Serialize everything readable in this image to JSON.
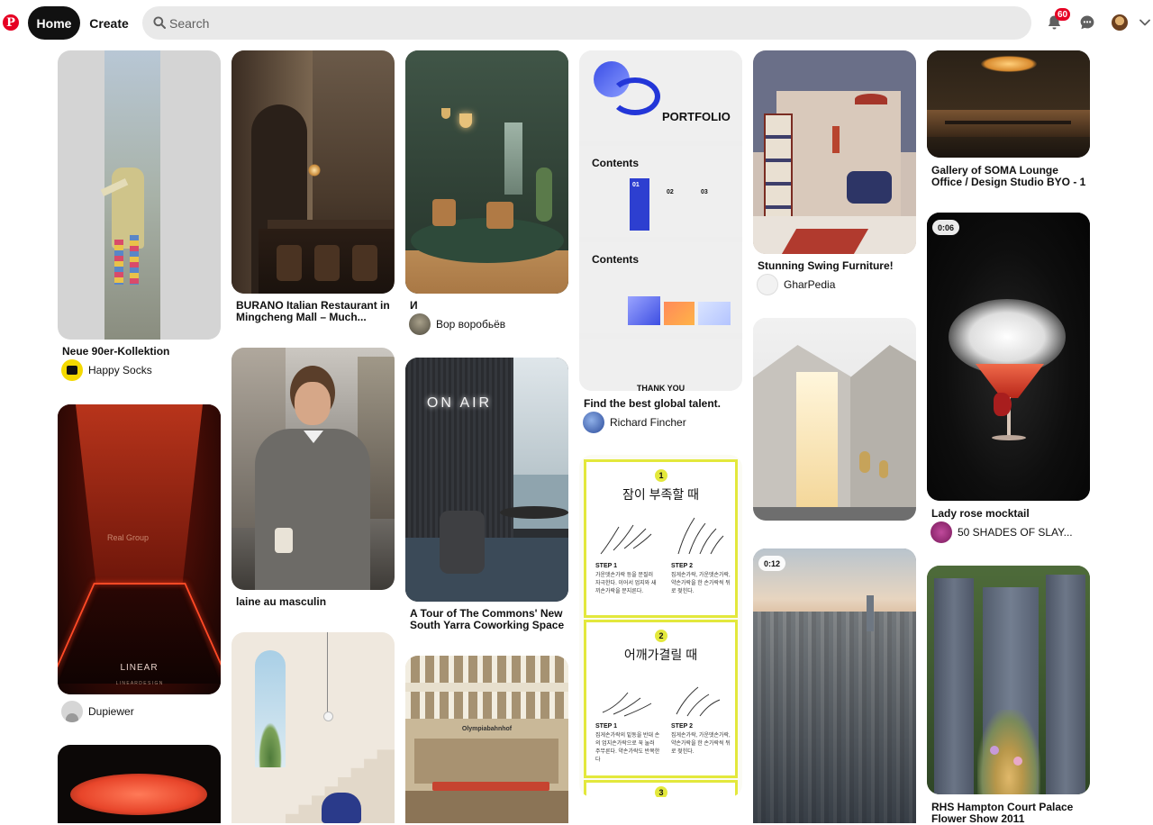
{
  "brand": {
    "logo_letter": "P",
    "accent": "#e60023"
  },
  "nav": {
    "home_label": "Home",
    "create_label": "Create"
  },
  "search": {
    "placeholder": "Search"
  },
  "header_icons": {
    "notifications": "bell-icon",
    "notification_count": "60",
    "messages": "chat-bubble-icon",
    "profile": "avatar",
    "account_menu": "chevron-down-icon"
  },
  "pins": [
    {
      "title": "Neue 90er-Kollektion",
      "author": "Happy Socks"
    },
    {
      "title": "",
      "author": "Dupiewer",
      "overlay_text": "LINEAR",
      "overlay_sub": "L I N E A R D E S I G N",
      "wall_text": "Real Group"
    },
    {
      "title": "BURANO Italian Restaurant in Mingcheng Mall – Much...",
      "author": ""
    },
    {
      "title": "laine au masculin",
      "author": ""
    },
    {
      "title": "И",
      "author": "Вор воробьёв"
    },
    {
      "title": "A Tour of The Commons' New South Yarra Coworking Space",
      "author": "",
      "sign_text": "ON AIR"
    },
    {
      "title": "",
      "author": "",
      "sign_text": "Olympiabahnhof"
    },
    {
      "title": "Find the best global talent.",
      "author": "Richard Fincher",
      "slide1_title": "PORTFOLIO",
      "slide2_title": "Contents",
      "slide3_title": "Contents",
      "nums": [
        "01",
        "02",
        "03"
      ],
      "slide4_text": "THANK YOU"
    },
    {
      "title": "",
      "author": "",
      "sec1_num": "1",
      "sec1_title": "잠이 부족할 때",
      "step1": "STEP 1",
      "step2": "STEP 2",
      "sec1_step1_text": "가운뎃손가락 등을 문질러 자극한다. 이어서 엄지와 새끼손가락을 문지른다.",
      "sec1_step2_text": "집게손가락, 가운뎃손가락, 약손가락을 한 손가락씩 뒤로 젖힌다.",
      "sec2_num": "2",
      "sec2_title": "어깨가결릴 때",
      "sec2_step1_text": "집게손가락의 밑동을 반대 손의 엄지손가락으로 꾹 눌러 주무른다. 약손가락도 반복한다",
      "sec2_step2_text": "집게손가락, 가운뎃손가락, 약손가락을 한 손가락씩 뒤로 젖힌다.",
      "sec3_num": "3"
    },
    {
      "title": "Stunning Swing Furniture!",
      "author": "GharPedia"
    },
    {
      "title": "",
      "author": ""
    },
    {
      "title": "",
      "author": "",
      "duration": "0:12"
    },
    {
      "title": "Gallery of SOMA Lounge Office / Design Studio BYO - 1",
      "author": ""
    },
    {
      "title": "Lady rose mocktail",
      "author": "50 SHADES OF SLAY...",
      "duration": "0:06"
    },
    {
      "title": "RHS Hampton Court Palace Flower Show 2011",
      "author": ""
    }
  ]
}
